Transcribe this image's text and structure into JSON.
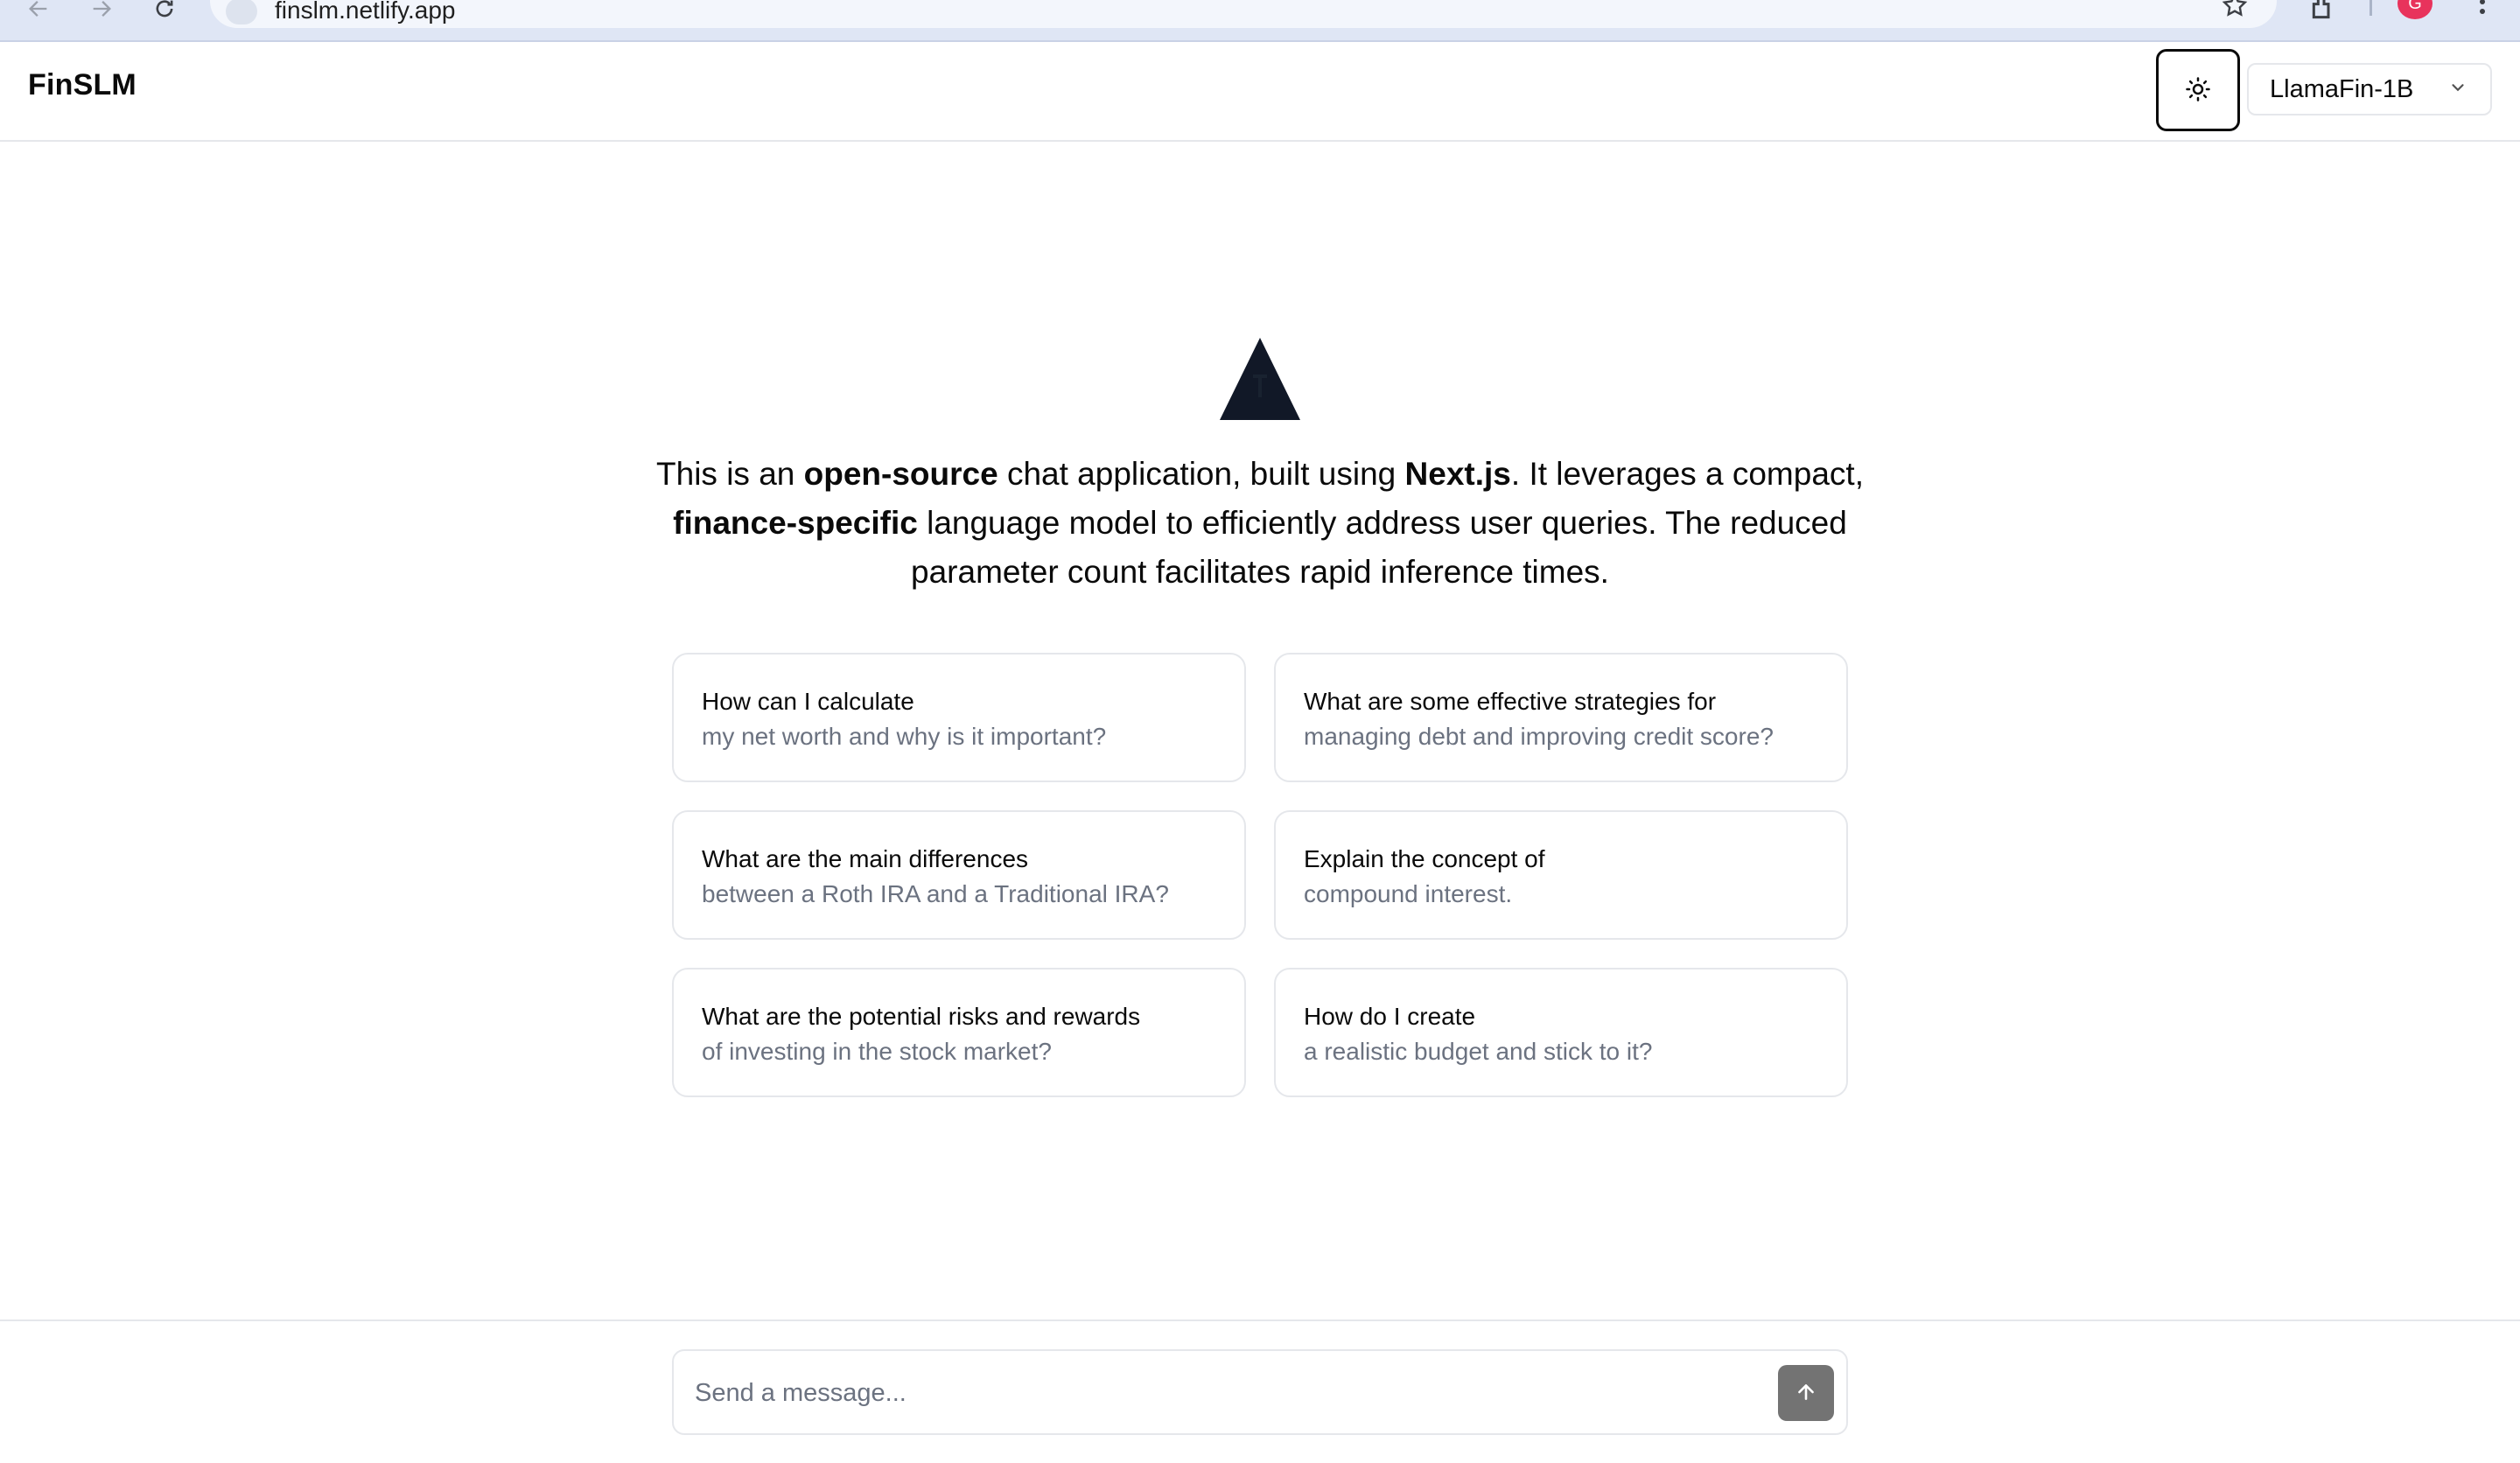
{
  "browser": {
    "url": "finslm.netlify.app",
    "profile_initial": "G"
  },
  "header": {
    "brand": "FinSLM",
    "theme_toggle_icon": "sun-icon",
    "model_select": {
      "selected": "LlamaFin-1B",
      "icon": "chevron-down-icon"
    }
  },
  "intro": {
    "logo_icon": "triangle-logo",
    "segments": [
      {
        "text": "This is an ",
        "bold": false
      },
      {
        "text": "open-source",
        "bold": true
      },
      {
        "text": " chat application, built using ",
        "bold": false
      },
      {
        "text": "Next.js",
        "bold": true
      },
      {
        "text": ". It leverages a compact, ",
        "bold": false
      },
      {
        "text": "finance-specific",
        "bold": true
      },
      {
        "text": " language model to efficiently address user queries. The reduced parameter count facilitates rapid inference times.",
        "bold": false
      }
    ]
  },
  "suggestions": [
    {
      "title": "How can I calculate",
      "subtitle": "my net worth and why is it important?"
    },
    {
      "title": "What are some effective strategies for",
      "subtitle": "managing debt and improving credit score?"
    },
    {
      "title": "What are the main differences",
      "subtitle": "between a Roth IRA and a Traditional IRA?"
    },
    {
      "title": "Explain the concept of",
      "subtitle": "compound interest."
    },
    {
      "title": "What are the potential risks and rewards",
      "subtitle": "of investing in the stock market?"
    },
    {
      "title": "How do I create",
      "subtitle": "a realistic budget and stick to it?"
    }
  ],
  "composer": {
    "placeholder": "Send a message...",
    "value": "",
    "send_icon": "arrow-up-icon"
  },
  "colors": {
    "text": "#0a0a0a",
    "muted": "#6b7280",
    "border": "#e5e7eb",
    "send_button": "#737373",
    "logo": "#111827"
  }
}
